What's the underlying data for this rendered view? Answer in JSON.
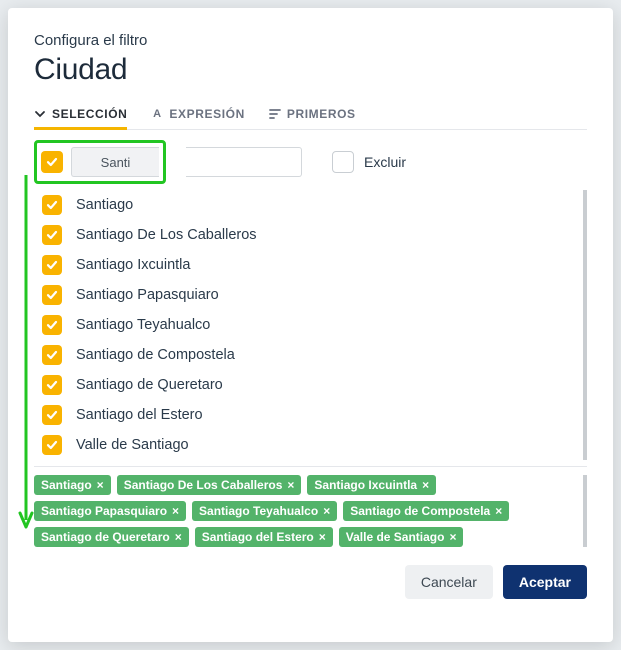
{
  "pretitle": "Configura el filtro",
  "title": "Ciudad",
  "tabs": {
    "selection": "SELECCIÓN",
    "expression": "EXPRESIÓN",
    "first": "PRIMEROS"
  },
  "search": {
    "value": "Santi"
  },
  "exclude": {
    "label": "Excluir"
  },
  "options": [
    "Santiago",
    "Santiago De Los Caballeros",
    "Santiago Ixcuintla",
    "Santiago Papasquiaro",
    "Santiago Teyahualco",
    "Santiago de Compostela",
    "Santiago de Queretaro",
    "Santiago del Estero",
    "Valle de Santiago"
  ],
  "chips": [
    "Santiago",
    "Santiago De Los Caballeros",
    "Santiago Ixcuintla",
    "Santiago Papasquiaro",
    "Santiago Teyahualco",
    "Santiago de Compostela",
    "Santiago de Queretaro",
    "Santiago del Estero",
    "Valle de Santiago"
  ],
  "footer": {
    "cancel": "Cancelar",
    "accept": "Aceptar"
  }
}
